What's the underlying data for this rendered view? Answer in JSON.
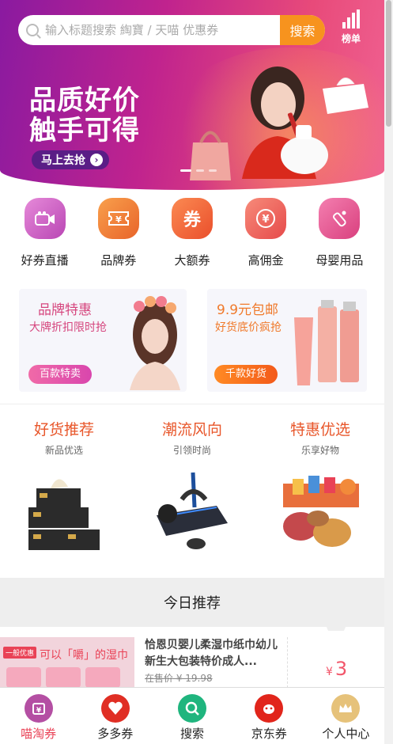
{
  "search": {
    "placeholder": "输入标题搜索 綯寶 / 天喵 优惠券",
    "button": "搜索"
  },
  "rank": {
    "label": "榜单"
  },
  "banner": {
    "title_line1": "品质好价",
    "title_line2": "触手可得",
    "cta": "马上去抢"
  },
  "categories": [
    {
      "label": "好券直播",
      "icon": "video-camera-icon",
      "color": "#d35fc9"
    },
    {
      "label": "品牌券",
      "icon": "ticket-icon",
      "color": "#f07a2c"
    },
    {
      "label": "大额券",
      "icon": "coupon-icon",
      "color": "#f0633a"
    },
    {
      "label": "高佣金",
      "icon": "yen-icon",
      "color": "#ef5a5a"
    },
    {
      "label": "母婴用品",
      "icon": "baby-bottle-icon",
      "color": "#e9508e"
    }
  ],
  "promos": [
    {
      "title": "品牌特惠",
      "subtitle": "大牌折扣限时抢",
      "button": "百款特卖"
    },
    {
      "title": "9.9元包邮",
      "subtitle": "好货底价疯抢",
      "button": "千款好货"
    }
  ],
  "recommend": [
    {
      "title": "好货推荐",
      "subtitle": "新品优选"
    },
    {
      "title": "潮流风向",
      "subtitle": "引领时尚"
    },
    {
      "title": "特惠优选",
      "subtitle": "乐享好物"
    }
  ],
  "today": {
    "title": "今日推荐"
  },
  "goods": {
    "tag": "一般优惠",
    "image_text": "可以「嚼」的湿巾",
    "title": "恰恩贝婴儿柔湿巾纸巾幼儿新生大包装特价成人...",
    "original_price": "在售价 ¥ 19.98",
    "currency": "¥",
    "price": "3"
  },
  "tabs": [
    {
      "label": "喵淘券",
      "icon": "coupon-cat-icon",
      "color": "#b44fa3",
      "active": true
    },
    {
      "label": "多多券",
      "icon": "pinduoduo-icon",
      "color": "#e02e24",
      "active": false
    },
    {
      "label": "搜索",
      "icon": "search-icon",
      "color": "#1fb57e",
      "active": false
    },
    {
      "label": "京东券",
      "icon": "jd-icon",
      "color": "#e1251b",
      "active": false
    },
    {
      "label": "个人中心",
      "icon": "crown-icon",
      "color": "#e6c27a",
      "active": false
    }
  ]
}
